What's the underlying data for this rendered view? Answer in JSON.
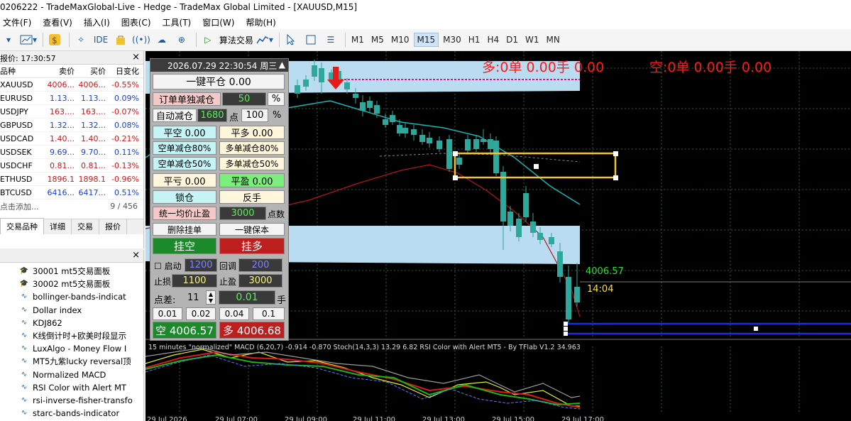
{
  "window": {
    "title": "0206222 - TradeMaxGlobal-Live - Hedge - TradeMax Global Limited - [XAUUSD,M15]"
  },
  "menu": [
    "文件(F)",
    "查看(V)",
    "插入(I)",
    "图表(C)",
    "工具(T)",
    "窗口(W)",
    "帮助(H)"
  ],
  "toolbar": {
    "algo_trading": "算法交易",
    "ide": "IDE",
    "timeframes": [
      "M1",
      "M5",
      "M10",
      "M15",
      "M30",
      "H1",
      "H4",
      "D1",
      "W1",
      "MN"
    ],
    "active_timeframe": "M15"
  },
  "market_watch": {
    "title": "报价: 17:30:57",
    "columns": [
      "品种",
      "卖价",
      "买价",
      "日变化"
    ],
    "rows": [
      {
        "symbol": "XAUUSD",
        "bid": "4006...",
        "ask": "4006...",
        "change": "-0.55%"
      },
      {
        "symbol": "EURUSD",
        "bid": "1.13...",
        "ask": "1.13...",
        "change": "0.09%"
      },
      {
        "symbol": "USDJPY",
        "bid": "163....",
        "ask": "163....",
        "change": "-0.07%"
      },
      {
        "symbol": "GBPUSD",
        "bid": "1.32...",
        "ask": "1.32...",
        "change": "0.08%"
      },
      {
        "symbol": "USDCAD",
        "bid": "1.40...",
        "ask": "1.40...",
        "change": "-0.21%"
      },
      {
        "symbol": "USDSEK",
        "bid": "9.69...",
        "ask": "9.70...",
        "change": "0.11%"
      },
      {
        "symbol": "USDCHF",
        "bid": "0.81...",
        "ask": "0.81...",
        "change": "-0.13%"
      },
      {
        "symbol": "ETHUSD",
        "bid": "1896.1",
        "ask": "1898.1",
        "change": "-0.96%"
      },
      {
        "symbol": "BTCUSD",
        "bid": "6416...",
        "ask": "6417...",
        "change": "0.51%"
      }
    ],
    "add_hint": "点击添加...",
    "count": "9 / 456",
    "tabs": [
      "交易品种",
      "详细",
      "交易",
      "报价"
    ]
  },
  "navigator": {
    "items": [
      "30001 mt5交易面板",
      "30002 mt5交易面板",
      "bollinger-bands-indicat",
      "Dollar index",
      "KDJ862",
      "K线倒计时+欧美时段显示",
      "LuxAlgo - Money Flow I",
      "MT5九紫lucky reversal顶",
      "Normalized MACD",
      "RSI Color with Alert MT",
      "rsi-inverse-fisher-transfo",
      "starc-bands-indicator"
    ]
  },
  "chart": {
    "long_stat": "多:0单 0.00手 0.00",
    "short_stat": "空:0单 0.00手 0.00",
    "price_label": "4006.57",
    "countdown": "14:04",
    "indicator_caption": "15 minutes \"normalized\" MACD (6,20,7) -0.914 -0.870 Stoch(14,3,3) 13.29 6.82 RSI Color with Alert MT5 - By TFlab V1.2 34.963",
    "time_axis": [
      "29 Jul 2026",
      "29 Jul 07:00",
      "29 Jul 09:00",
      "29 Jul 11:00",
      "29 Jul 13:00",
      "29 Jul 15:00",
      "29 Jul 17:00"
    ]
  },
  "panel": {
    "header": "2026.07.29 22:30:54 周三",
    "close_all": "一键平仓 0.00",
    "order_reduce": "订单单独减仓",
    "order_reduce_val": "50",
    "pct": "%",
    "auto_reduce": "自动减仓",
    "auto_points": "1680",
    "dian": "点",
    "auto_pct": "100",
    "close_short": "平空 0.00",
    "close_long": "平多 0.00",
    "short_reduce80": "空单减仓80%",
    "long_reduce80": "多单减仓80%",
    "short_reduce50": "空单减仓50%",
    "long_reduce50": "多单减仓50%",
    "close_loss": "平亏 0.00",
    "close_profit": "平盈 0.00",
    "lock": "锁仓",
    "reverse": "反手",
    "avg_tp": "统一均价止盈",
    "avg_tp_val": "3000",
    "dianshu": "点数",
    "delete_pending": "删除挂单",
    "breakeven": "一键保本",
    "pending_short": "挂空",
    "pending_long": "挂多",
    "enable": "启动",
    "enable_val": "1200",
    "pullback": "回调",
    "pullback_val": "200",
    "sl": "止损",
    "sl_val": "1100",
    "tp": "止盈",
    "tp_val": "3000",
    "spread": "点差:",
    "spread_val": "11",
    "lot": "0.01",
    "shou": "手",
    "lot_presets": [
      "0.01",
      "0.02",
      "0.04",
      "0.1"
    ],
    "sell_btn": "空 4006.57",
    "buy_btn": "多 4006.68"
  }
}
